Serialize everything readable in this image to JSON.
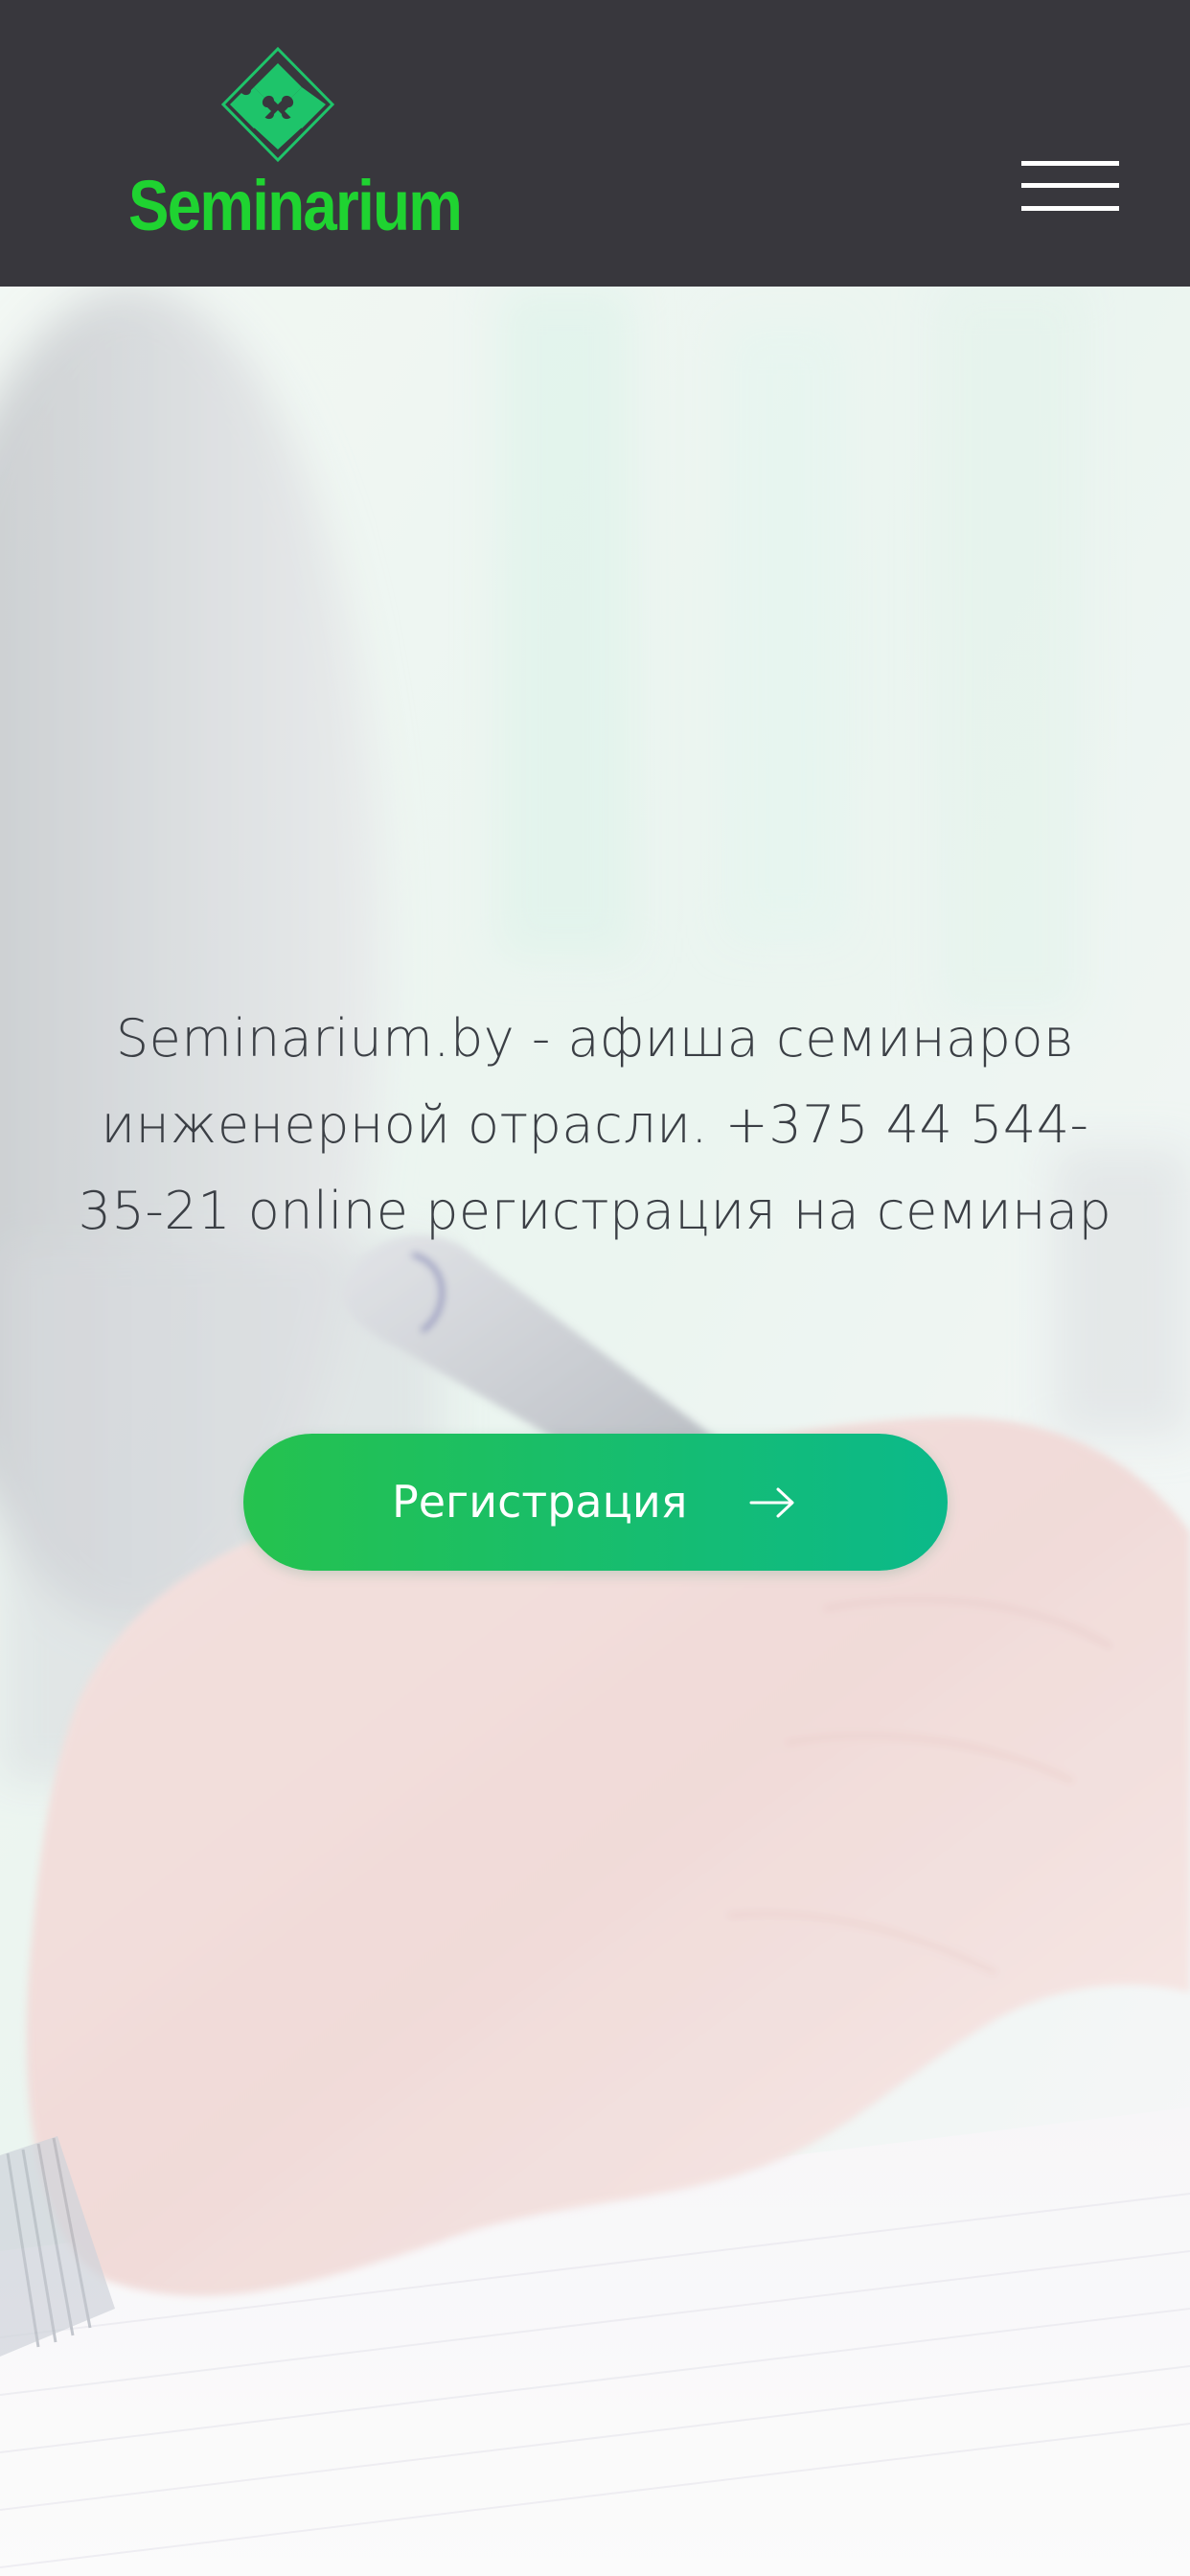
{
  "header": {
    "logo_text": "Seminarium",
    "logo_icon": "puzzle-icon",
    "menu_icon": "hamburger-menu-icon"
  },
  "hero": {
    "headline": "Seminarium.by - афиша семинаров инженерной отрасли. +375 44 544-35-21 online регистрация на семинар",
    "register_label": "Регистрация",
    "register_icon": "arrow-right-icon",
    "background_image": "hand-writing-with-pen-photo"
  },
  "colors": {
    "header_background": "#38373d",
    "logo_green": "#1fd331",
    "logo_mark_green": "#1ec46a",
    "button_gradient_start": "#25c24e",
    "button_gradient_end": "#0bb98a",
    "headline_text": "#3b3f45",
    "button_text": "#ffffff"
  }
}
